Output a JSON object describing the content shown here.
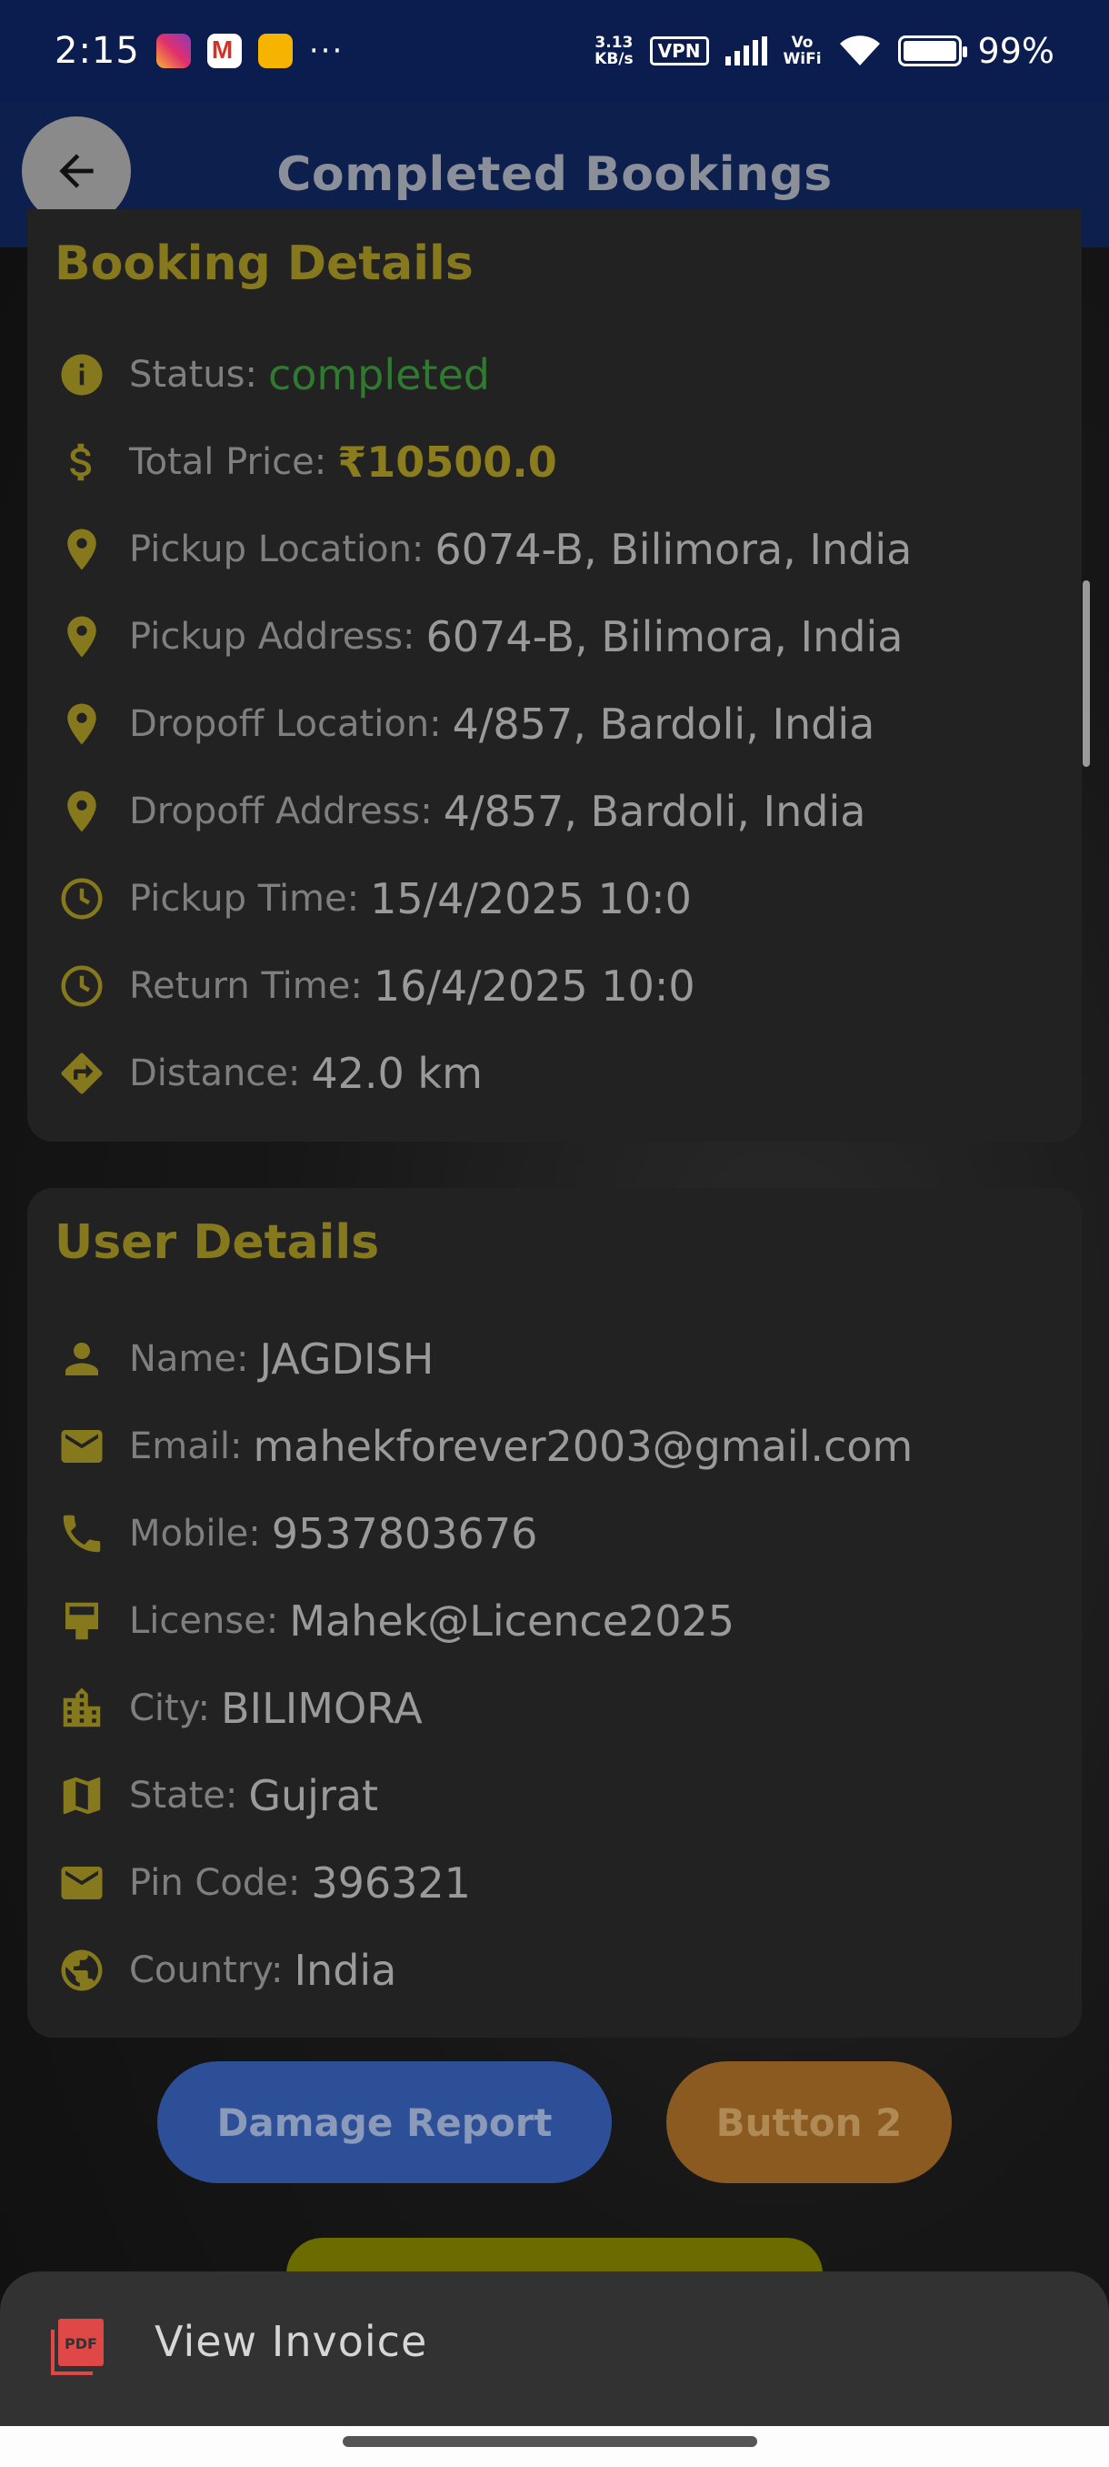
{
  "status_bar": {
    "time": "2:15",
    "notif_icons": [
      "instagram-icon",
      "gmail-icon",
      "notes-icon"
    ],
    "overflow": "···",
    "net_speed_top": "3.13",
    "net_speed_bottom": "KB/s",
    "vpn": "VPN",
    "vowifi_top": "Vo",
    "vowifi_bottom": "WiFi",
    "battery": "99%"
  },
  "app_bar": {
    "title": "Completed Bookings",
    "back_icon": "arrow-back-icon"
  },
  "booking_details": {
    "title": "Booking Details",
    "rows": [
      {
        "icon": "info-icon",
        "label": "Status:",
        "value": "completed"
      },
      {
        "icon": "dollar-icon",
        "label": "Total Price:",
        "value": "₹10500.0"
      },
      {
        "icon": "location-pin-icon",
        "label": "Pickup Location:",
        "value": "6074-B, Bilimora, India"
      },
      {
        "icon": "location-pin-icon",
        "label": "Pickup Address:",
        "value": "6074-B, Bilimora, India"
      },
      {
        "icon": "location-pin-icon",
        "label": "Dropoff Location:",
        "value": "4/857, Bardoli, India"
      },
      {
        "icon": "location-pin-icon",
        "label": "Dropoff Address:",
        "value": "4/857, Bardoli, India"
      },
      {
        "icon": "clock-icon",
        "label": "Pickup Time:",
        "value": "15/4/2025 10:0"
      },
      {
        "icon": "clock-icon",
        "label": "Return Time:",
        "value": "16/4/2025 10:0"
      },
      {
        "icon": "directions-icon",
        "label": "Distance:",
        "value": "42.0 km"
      }
    ]
  },
  "user_details": {
    "title": "User Details",
    "rows": [
      {
        "icon": "person-icon",
        "label": "Name:",
        "value": "JAGDISH"
      },
      {
        "icon": "mail-icon",
        "label": "Email:",
        "value": "mahekforever2003@gmail.com"
      },
      {
        "icon": "phone-icon",
        "label": "Mobile:",
        "value": "9537803676"
      },
      {
        "icon": "license-card-icon",
        "label": "License:",
        "value": "Mahek@Licence2025"
      },
      {
        "icon": "city-icon",
        "label": "City:",
        "value": "BILIMORA"
      },
      {
        "icon": "map-icon",
        "label": "State:",
        "value": "Gujrat"
      },
      {
        "icon": "mail-icon",
        "label": "Pin Code:",
        "value": "396321"
      },
      {
        "icon": "globe-icon",
        "label": "Country:",
        "value": "India"
      }
    ]
  },
  "buttons": {
    "damage_report": "Damage Report",
    "button_2": "Button 2"
  },
  "bottom_sheet": {
    "label": "View Invoice",
    "icon": "pdf-icon",
    "icon_text": "PDF"
  },
  "colors": {
    "accent_gold": "#86791d",
    "status_green": "#2f7a2f",
    "header_blue": "#0c1f4d"
  }
}
